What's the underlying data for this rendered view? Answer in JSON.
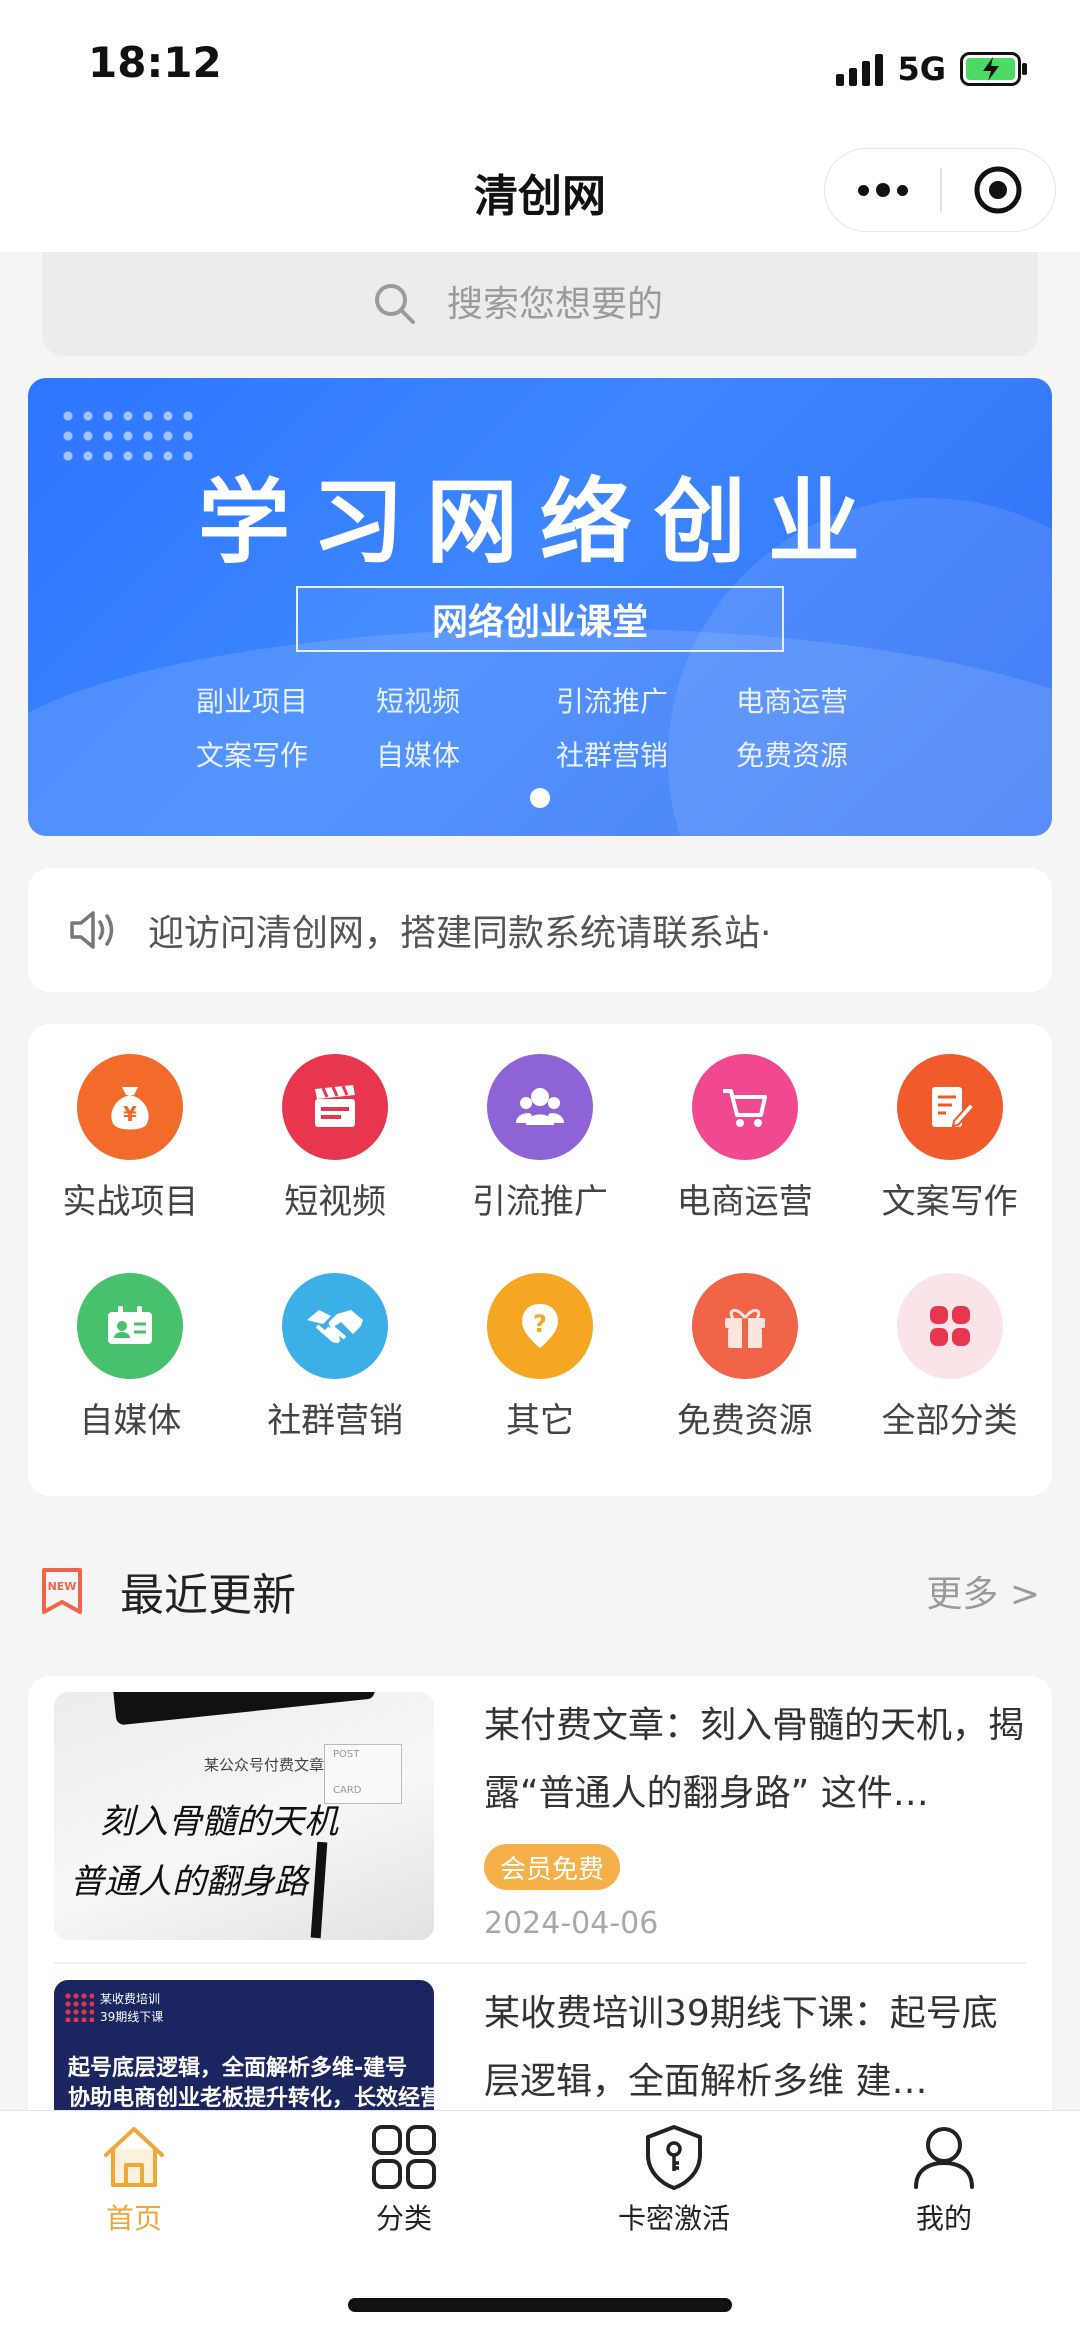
{
  "status_bar": {
    "time": "18:12",
    "network": "5G"
  },
  "nav": {
    "title": "清创网"
  },
  "search": {
    "placeholder": "搜索您想要的"
  },
  "banner": {
    "title": "学习网络创业",
    "subtitle": "网络创业课堂",
    "tags": [
      "副业项目",
      "短视频",
      "引流推广",
      "电商运营",
      "文案写作",
      "自媒体",
      "社群营销",
      "免费资源"
    ]
  },
  "notice": {
    "text": "迎访问清创网，搭建同款系统请联系站·"
  },
  "categories": [
    {
      "label": "实战项目",
      "icon": "money-bag-icon",
      "color": "#f26b2a"
    },
    {
      "label": "短视频",
      "icon": "clapperboard-icon",
      "color": "#e8364f"
    },
    {
      "label": "引流推广",
      "icon": "people-icon",
      "color": "#8e63d6"
    },
    {
      "label": "电商运营",
      "icon": "cart-icon",
      "color": "#f0498f"
    },
    {
      "label": "文案写作",
      "icon": "document-pen-icon",
      "color": "#f15a2b"
    },
    {
      "label": "自媒体",
      "icon": "id-card-icon",
      "color": "#47c16b"
    },
    {
      "label": "社群营销",
      "icon": "handshake-icon",
      "color": "#3cb0e6"
    },
    {
      "label": "其它",
      "icon": "question-icon",
      "color": "#f5a623"
    },
    {
      "label": "免费资源",
      "icon": "gift-icon",
      "color": "#f06448"
    },
    {
      "label": "全部分类",
      "icon": "four-petal-icon",
      "color": "#e7364f"
    }
  ],
  "recent": {
    "title": "最近更新",
    "more": "更多 >",
    "badge_text": "NEW",
    "articles": [
      {
        "title": "某付费文章：刻入骨髓的天机，揭露“普通人的翻身路” 这件…",
        "badge": "会员免费",
        "date": "2024-04-06",
        "thumb_small": "某公众号付费文章",
        "thumb_line1": "刻入骨髓的天机",
        "thumb_line2": "普通人的翻身路",
        "thumb_post": "POST",
        "thumb_card": "CARD"
      },
      {
        "title": "某收费培训39期线下课：起号底层逻辑，全面解析多维 建…",
        "thumb_small1": "某收费培训",
        "thumb_small2": "39期线下课",
        "thumb_line1": "起号底层逻辑，全面解析多维-建号",
        "thumb_line2": "协助电商创业老板提升转化，长效经营"
      }
    ]
  },
  "tabbar": {
    "items": [
      {
        "label": "首页",
        "icon": "home-icon",
        "active": true
      },
      {
        "label": "分类",
        "icon": "grid-icon",
        "active": false
      },
      {
        "label": "卡密激活",
        "icon": "shield-key-icon",
        "active": false
      },
      {
        "label": "我的",
        "icon": "user-icon",
        "active": false
      }
    ],
    "active_color": "#f0a73a"
  }
}
